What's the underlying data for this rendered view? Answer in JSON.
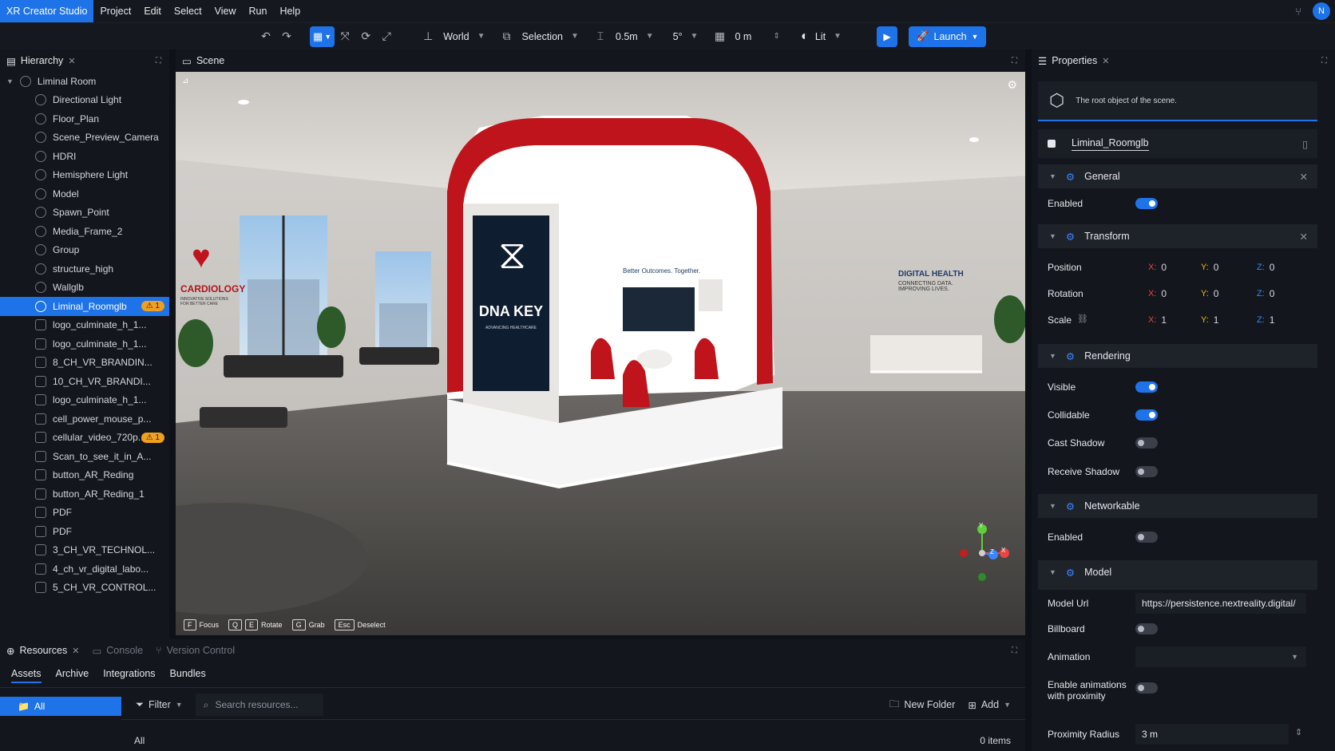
{
  "menubar": {
    "app_name": "XR Creator Studio",
    "items": [
      "Project",
      "Edit",
      "Select",
      "View",
      "Run",
      "Help"
    ],
    "avatar_initial": "N"
  },
  "toolbar": {
    "space": "World",
    "snap_mode": "Selection",
    "translation_snap": "0.5m",
    "rotation_snap": "5°",
    "grid_height": "0 m",
    "render_mode": "Lit",
    "launch_label": "Launch"
  },
  "hierarchy": {
    "tab_label": "Hierarchy",
    "root": "Liminal Room",
    "items": [
      {
        "label": "Directional Light",
        "icon": "light-icon"
      },
      {
        "label": "Floor_Plan",
        "icon": "model-icon"
      },
      {
        "label": "Scene_Preview_Camera",
        "icon": "camera-icon"
      },
      {
        "label": "HDRI",
        "icon": "hdri-icon"
      },
      {
        "label": "Hemisphere Light",
        "icon": "light-icon"
      },
      {
        "label": "Model",
        "icon": "model-icon"
      },
      {
        "label": "Spawn_Point",
        "icon": "spawn-icon"
      },
      {
        "label": "Media_Frame_2",
        "icon": "media-icon"
      },
      {
        "label": "Group",
        "icon": "group-icon"
      },
      {
        "label": "structure_high",
        "icon": "model-icon"
      },
      {
        "label": "Wallglb",
        "icon": "model-icon"
      },
      {
        "label": "Liminal_Roomglb",
        "icon": "model-icon",
        "selected": true,
        "badge": "⚠ 1"
      },
      {
        "label": "logo_culminate_h_1...",
        "icon": "image-icon"
      },
      {
        "label": "logo_culminate_h_1...",
        "icon": "image-icon"
      },
      {
        "label": "8_CH_VR_BRANDIN...",
        "icon": "image-icon"
      },
      {
        "label": "10_CH_VR_BRANDI...",
        "icon": "image-icon"
      },
      {
        "label": "logo_culminate_h_1...",
        "icon": "image-icon"
      },
      {
        "label": "cell_power_mouse_p...",
        "icon": "image-icon"
      },
      {
        "label": "cellular_video_720p...",
        "icon": "video-icon",
        "badge": "⚠ 1"
      },
      {
        "label": "Scan_to_see_it_in_A...",
        "icon": "image-icon"
      },
      {
        "label": "button_AR_Reding",
        "icon": "image-icon"
      },
      {
        "label": "button_AR_Reding_1",
        "icon": "image-icon"
      },
      {
        "label": "PDF",
        "icon": "pdf-icon"
      },
      {
        "label": "PDF",
        "icon": "pdf-icon"
      },
      {
        "label": "3_CH_VR_TECHNOL...",
        "icon": "image-icon"
      },
      {
        "label": "4_ch_vr_digital_labo...",
        "icon": "image-icon"
      },
      {
        "label": "5_CH_VR_CONTROL...",
        "icon": "image-icon"
      }
    ]
  },
  "scene": {
    "tab_label": "Scene",
    "hints": [
      {
        "key": "F",
        "label": "Focus"
      },
      {
        "key": "Q",
        "label": ""
      },
      {
        "key": "E",
        "label": "Rotate"
      },
      {
        "key": "G",
        "label": "Grab"
      },
      {
        "key": "Esc",
        "label": "Deselect"
      }
    ],
    "booth_sign": "DNA KEY",
    "booth_sign_sub": "ADVANCING HEALTHCARE",
    "wall_left_title": "CARDIOLOGY",
    "wall_left_sub": "INNOVATIVE SOLUTIONS FOR BETTER CARE",
    "wall_right_title": "DIGITAL HEALTH",
    "wall_right_sub": "CONNECTING DATA. IMPROVING LIVES.",
    "booth_inner_text": "Better Outcomes. Together.",
    "gizmo": {
      "x": "X",
      "y": "Y",
      "z": "Z"
    }
  },
  "properties": {
    "tab_label": "Properties",
    "description": "The root object of the scene.",
    "object_name": "Liminal_Roomglb",
    "sections": {
      "general": "General",
      "transform": "Transform",
      "rendering": "Rendering",
      "networkable": "Networkable",
      "model": "Model"
    },
    "general_enabled_label": "Enabled",
    "general_enabled": true,
    "position_label": "Position",
    "rotation_label": "Rotation",
    "scale_label": "Scale",
    "position": {
      "x": "0",
      "y": "0",
      "z": "0"
    },
    "rotation": {
      "x": "0",
      "y": "0",
      "z": "0"
    },
    "scale": {
      "x": "1",
      "y": "1",
      "z": "1"
    },
    "axis": {
      "x": "X:",
      "y": "Y:",
      "z": "Z:"
    },
    "visible_label": "Visible",
    "collidable_label": "Collidable",
    "cast_shadow_label": "Cast Shadow",
    "receive_shadow_label": "Receive Shadow",
    "net_enabled_label": "Enabled",
    "model_url_label": "Model Url",
    "model_url": "https://persistence.nextreality.digital/",
    "billboard_label": "Billboard",
    "animation_label": "Animation",
    "enable_anim_label": "Enable animations with proximity",
    "proximity_radius_label": "Proximity Radius",
    "proximity_radius": "3 m"
  },
  "bottom": {
    "tabs": [
      "Resources",
      "Console",
      "Version Control"
    ],
    "subtabs": [
      "Assets",
      "Archive",
      "Integrations",
      "Bundles"
    ],
    "tree_all": "All",
    "filter_label": "Filter",
    "search_placeholder": "Search resources...",
    "new_folder_label": "New Folder",
    "add_label": "Add",
    "breadcrumb": "All",
    "item_count": "0 items"
  },
  "colors": {
    "accent": "#1e73e8",
    "warning": "#f0a020",
    "booth_red": "#c0141c"
  }
}
